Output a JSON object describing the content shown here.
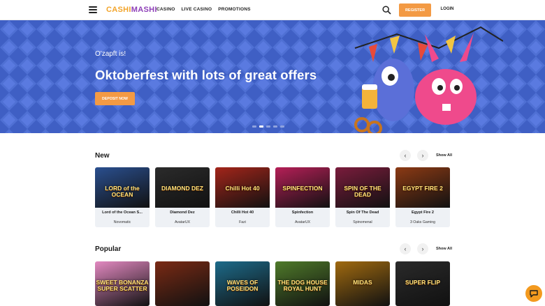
{
  "header": {
    "logo_part1": "CASHI",
    "logo_part2": "MASHI",
    "nav": [
      "CASINO",
      "LIVE CASINO",
      "PROMOTIONS"
    ],
    "register_label": "REGISTER",
    "login_label": "LOGIN",
    "icons": [
      "menu-icon",
      "search-icon"
    ]
  },
  "hero": {
    "subtitle": "O'zapft is!",
    "title": "Oktoberfest with lots of great offers",
    "cta_label": "DEPOSIT NOW",
    "slides": 5,
    "active_slide": 1
  },
  "sections": {
    "new": {
      "title": "New",
      "show_all": "Show All",
      "games": [
        {
          "thumb": "LORD of the OCEAN",
          "name": "Lord of the Ocean S...",
          "provider": "Novomatic",
          "color": "#2a4f8f"
        },
        {
          "thumb": "DIAMOND DEZ",
          "name": "Diamond Dez",
          "provider": "AvatarUX",
          "color": "#2b2b2b"
        },
        {
          "thumb": "Chilli Hot 40",
          "name": "Chilli Hot 40",
          "provider": "Fazi",
          "color": "#a3251a"
        },
        {
          "thumb": "SPINFECTION",
          "name": "Spinfection",
          "provider": "AvatarUX",
          "color": "#b51f57"
        },
        {
          "thumb": "SPIN OF THE DEAD",
          "name": "Spin Of The Dead",
          "provider": "Spinomenal",
          "color": "#7a1c3c"
        },
        {
          "thumb": "EGYPT FIRE 2",
          "name": "Egypt Fire 2",
          "provider": "3 Oaks Gaming",
          "color": "#8c3a14"
        }
      ]
    },
    "popular": {
      "title": "Popular",
      "show_all": "Show All",
      "games": [
        {
          "thumb": "SWEET BONANZA SUPER SCATTER",
          "color": "#e389c1"
        },
        {
          "thumb": "",
          "color": "#7a2a14"
        },
        {
          "thumb": "WAVES OF POSEIDON",
          "color": "#1d6b8a"
        },
        {
          "thumb": "THE DOG HOUSE ROYAL HUNT",
          "color": "#4f7a2a"
        },
        {
          "thumb": "MIDAS",
          "color": "#a06a10"
        },
        {
          "thumb": "SUPER FLIP",
          "color": "#2a2a2a"
        }
      ]
    }
  },
  "colors": {
    "accent": "#f39a44",
    "hero_bg": "#3f5fc4"
  }
}
